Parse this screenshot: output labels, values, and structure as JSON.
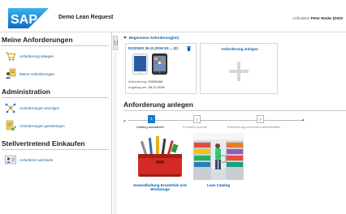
{
  "header": {
    "logo_text": "SAP",
    "app_title": "Demo Lean Request",
    "requester_label": "Anforderer",
    "requester_name": "Peter Reske (D020"
  },
  "sidebar": {
    "sections": [
      {
        "title": "Meine Anforderungen",
        "items": [
          {
            "label": "Anforderung anlegen",
            "icon": "cart-icon"
          },
          {
            "label": "Meine Anforderungen",
            "icon": "user-list-icon"
          }
        ]
      },
      {
        "title": "Administration",
        "items": [
          {
            "label": "Anforderungen anzeigen",
            "icon": "network-icon"
          },
          {
            "label": "Anforderungen genehmigen",
            "icon": "approve-document-icon"
          }
        ]
      },
      {
        "title": "Stellvertretend Einkaufen",
        "items": [
          {
            "label": "Anforderer wechseln",
            "icon": "switch-user-icon"
          }
        ]
      }
    ]
  },
  "cart": {
    "heading": "Begonnene Anforderung(en)",
    "id": "DG20402 26.11.2018 00:... (2)",
    "requisition_label": "Anforderung:",
    "requisition_value": "10000484",
    "created_label": "Angelegt am:",
    "created_value": "26.11.2018",
    "add_title": "Anforderung anlegen"
  },
  "create": {
    "title": "Anforderung anlegen",
    "steps": [
      {
        "number": "1",
        "label": "Katalog auswählen",
        "active": true
      },
      {
        "number": "2",
        "label": "Produkte suchen",
        "active": false
      },
      {
        "number": "3",
        "label": "Anforderung versenden/überarbeiten",
        "active": false
      }
    ]
  },
  "catalogs": [
    {
      "label_line1": "Instandhaltung Ersatzteile und",
      "label_line2": "Werkzeuge",
      "icon": "toolbox-icon"
    },
    {
      "label_line1": "Lean Catalog",
      "label_line2": "",
      "icon": "supermarket-icon"
    }
  ],
  "colors": {
    "sap_blue": "#1a7cc9",
    "link_blue": "#0a5ea8",
    "toolbox_red": "#d42a25"
  }
}
